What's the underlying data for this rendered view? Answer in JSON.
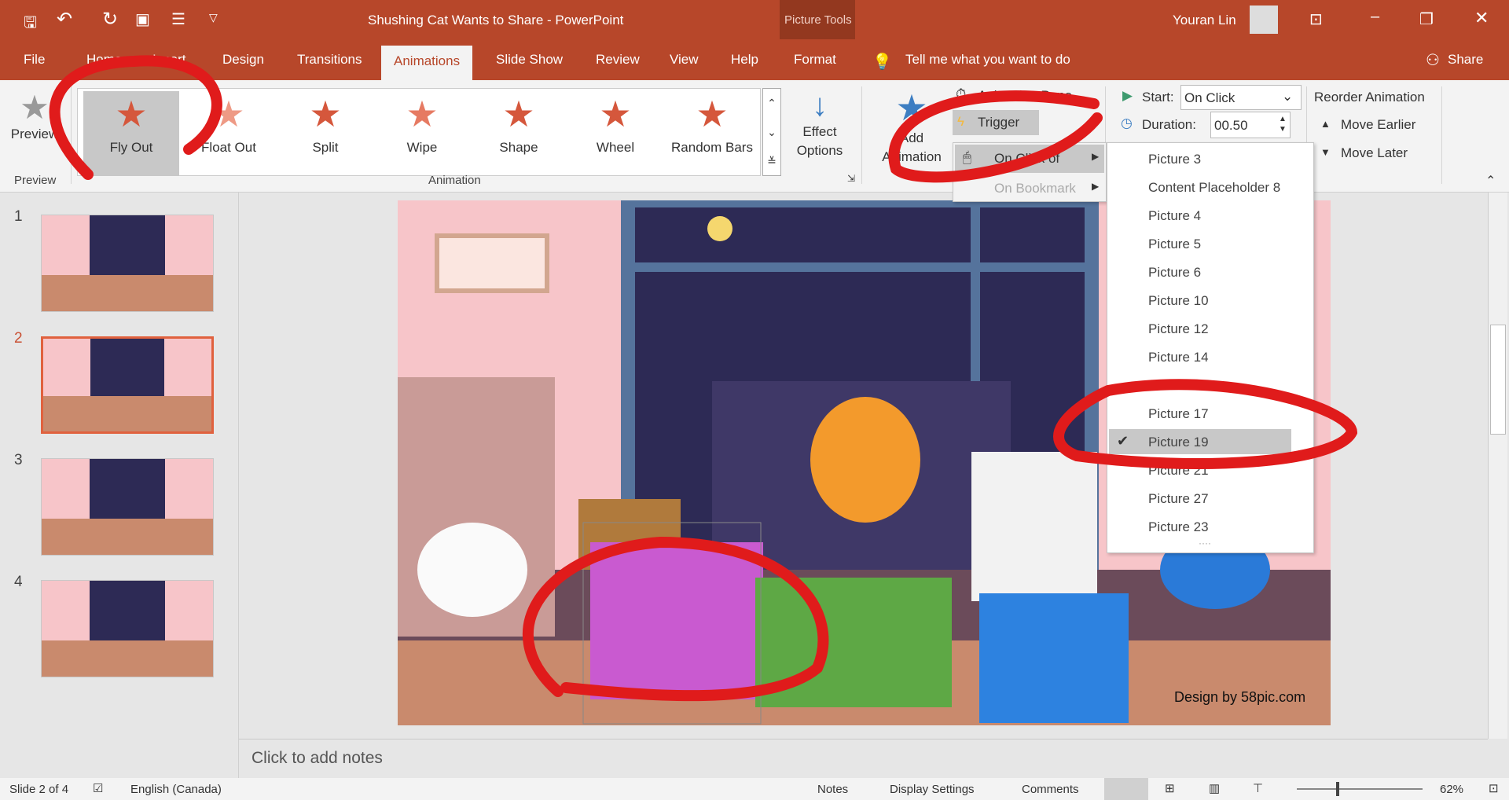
{
  "title_bar": {
    "title": "Shushing Cat Wants to Share  -  PowerPoint",
    "context": "Picture Tools",
    "user": "Youran Lin"
  },
  "tabs": [
    "File",
    "Home",
    "Insert",
    "Design",
    "Transitions",
    "Animations",
    "Slide Show",
    "Review",
    "View",
    "Help",
    "Format"
  ],
  "tell_me": "Tell me what you want to do",
  "share": "Share",
  "ribbon": {
    "preview": {
      "label": "Preview",
      "group": "Preview"
    },
    "gallery": [
      {
        "label": "Fly Out",
        "selected": true
      },
      {
        "label": "Float Out"
      },
      {
        "label": "Split"
      },
      {
        "label": "Wipe"
      },
      {
        "label": "Shape"
      },
      {
        "label": "Wheel"
      },
      {
        "label": "Random Bars"
      }
    ],
    "effect_options": [
      "Effect",
      "Options"
    ],
    "group_animation": "Animation",
    "add_animation": [
      "Add",
      "Animation"
    ],
    "animation_pane": "Animation Pane",
    "trigger": "Trigger",
    "start_label": "Start:",
    "start_value": "On Click",
    "duration_label": "Duration:",
    "duration_value": "00.50",
    "reorder": "Reorder Animation",
    "move_earlier": "Move Earlier",
    "move_later": "Move Later"
  },
  "trigger_menu": {
    "items": [
      "On Click of",
      "On Bookmark"
    ]
  },
  "picture_menu": {
    "items": [
      "Picture 3",
      "Content Placeholder 8",
      "Picture 4",
      "Picture 5",
      "Picture 6",
      "Picture 10",
      "Picture 12",
      "Picture 14",
      "",
      "Picture 17",
      "Picture 19",
      "Picture 21",
      "Picture 27",
      "Picture 23"
    ],
    "checked": "Picture 19"
  },
  "slides": [
    "1",
    "2",
    "3",
    "4"
  ],
  "selected_slide": 2,
  "slide": {
    "credit": "Design by 58pic.com"
  },
  "notes_placeholder": "Click to add notes",
  "status": {
    "slide": "Slide 2 of 4",
    "language": "English (Canada)",
    "notes": "Notes",
    "display": "Display Settings",
    "comments": "Comments",
    "zoom": "62%",
    "zoom_percent": 62
  },
  "colors": {
    "accent": "#b7472a",
    "annotation": "#e01b1b"
  }
}
